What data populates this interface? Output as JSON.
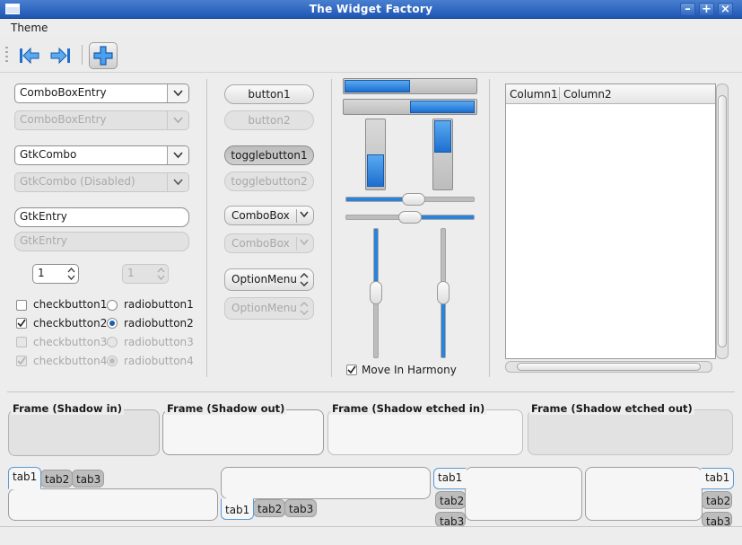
{
  "window": {
    "title": "The Widget Factory"
  },
  "menubar": {
    "items": [
      "Theme"
    ]
  },
  "col1": {
    "comboboxentry": "ComboBoxEntry",
    "comboboxentry_disabled": "ComboBoxEntry",
    "gtkcombo": "GtkCombo",
    "gtkcombo_disabled": "GtkCombo (Disabled)",
    "entry": "GtkEntry",
    "entry_disabled": "GtkEntry",
    "spin1": "1",
    "spin2": "1",
    "check1": "checkbutton1",
    "check2": "checkbutton2",
    "check3": "checkbutton3",
    "check4": "checkbutton4",
    "radio1": "radiobutton1",
    "radio2": "radiobutton2",
    "radio3": "radiobutton3",
    "radio4": "radiobutton4"
  },
  "col2": {
    "button1": "button1",
    "button2": "button2",
    "toggle1": "togglebutton1",
    "toggle2": "togglebutton2",
    "combobox": "ComboBox",
    "combobox_disabled": "ComboBox",
    "optionmenu": "OptionMenu",
    "optionmenu_disabled": "OptionMenu"
  },
  "col3": {
    "move_in_harmony": "Move In Harmony",
    "progress_h1": 0.5,
    "progress_h2": 0.5,
    "progress_v1": 0.5,
    "progress_v2": 0.5
  },
  "treeview": {
    "columns": [
      "Column1",
      "Column2"
    ]
  },
  "frames": [
    "Frame (Shadow in)",
    "Frame (Shadow out)",
    "Frame (Shadow etched in)",
    "Frame (Shadow etched out)"
  ],
  "notebooks": [
    {
      "tabs": [
        "tab1",
        "tab2",
        "tab3"
      ],
      "position": "top"
    },
    {
      "tabs": [
        "tab1",
        "tab2",
        "tab3"
      ],
      "position": "bottom"
    },
    {
      "tabs": [
        "tab1",
        "tab2",
        "tab3"
      ],
      "position": "left"
    },
    {
      "tabs": [
        "tab1",
        "tab2",
        "tab3"
      ],
      "position": "right"
    }
  ],
  "icons": [
    "window-icon",
    "minimize-icon",
    "maximize-icon",
    "close-icon",
    "go-first-icon",
    "go-last-icon",
    "add-icon"
  ],
  "colors": {
    "accent": "#2a83da",
    "titlebar": "#1d56b4"
  }
}
